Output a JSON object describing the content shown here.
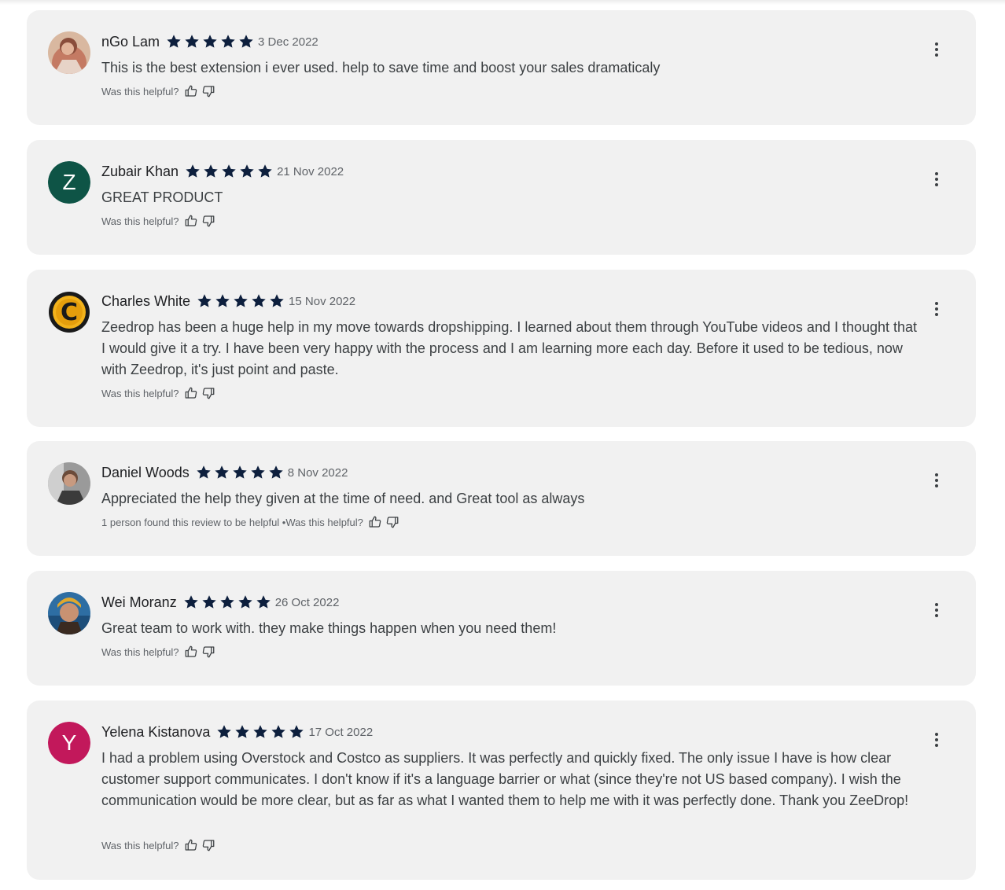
{
  "reviews": [
    {
      "name": "nGo Lam",
      "rating": 5,
      "date": "3 Dec 2022",
      "text": "This is the best extension i ever used. help to save time and boost your sales dramaticaly",
      "helpful_count_text": "",
      "helpful_prompt": "Was this helpful?",
      "avatar_type": "photo"
    },
    {
      "name": "Zubair Khan",
      "rating": 5,
      "date": "21 Nov 2022",
      "text": "GREAT PRODUCT",
      "helpful_count_text": "",
      "helpful_prompt": "Was this helpful?",
      "avatar_type": "letter",
      "avatar_letter": "Z",
      "avatar_color": "#0e5446"
    },
    {
      "name": "Charles White",
      "rating": 5,
      "date": "15 Nov 2022",
      "text": "Zeedrop has been a huge help in my move towards dropshipping. I learned about them through YouTube videos and I thought that I would give it a try. I have been very happy with the process and I am learning more each day. Before it used to be tedious, now with Zeedrop, it's just point and paste.",
      "helpful_count_text": "",
      "helpful_prompt": "Was this helpful?",
      "avatar_type": "logo-c"
    },
    {
      "name": "Daniel Woods",
      "rating": 5,
      "date": "8 Nov 2022",
      "text": "Appreciated the help they given at the time of need. and Great tool as always",
      "helpful_count_text": "1 person found this review to be helpful • ",
      "helpful_prompt": "Was this helpful?",
      "avatar_type": "photo"
    },
    {
      "name": "Wei Moranz",
      "rating": 5,
      "date": "26 Oct 2022",
      "text": "Great team to work with. they make things happen when you need them!",
      "helpful_count_text": "",
      "helpful_prompt": "Was this helpful?",
      "avatar_type": "photo"
    },
    {
      "name": "Yelena Kistanova",
      "rating": 5,
      "date": "17 Oct 2022",
      "text": "I had a problem using Overstock and Costco as suppliers. It was perfectly and quickly fixed. The only issue I have is how clear customer support communicates. I don't know if it's a language barrier or what (since they're not US based company). I wish the communication would be more clear, but as far as what I wanted them to help me with it was perfectly done.  Thank you ZeeDrop!",
      "helpful_count_text": "",
      "helpful_prompt": "Was this helpful?",
      "avatar_type": "letter",
      "avatar_letter": "Y",
      "avatar_color": "#c2185b"
    }
  ],
  "icons": {
    "star": "star-icon",
    "thumbs_up": "thumbs-up-icon",
    "thumbs_down": "thumbs-down-icon",
    "more": "more-vert-icon"
  },
  "colors": {
    "card_background": "#f1f1f1",
    "star_fill": "#0d1f3d"
  }
}
